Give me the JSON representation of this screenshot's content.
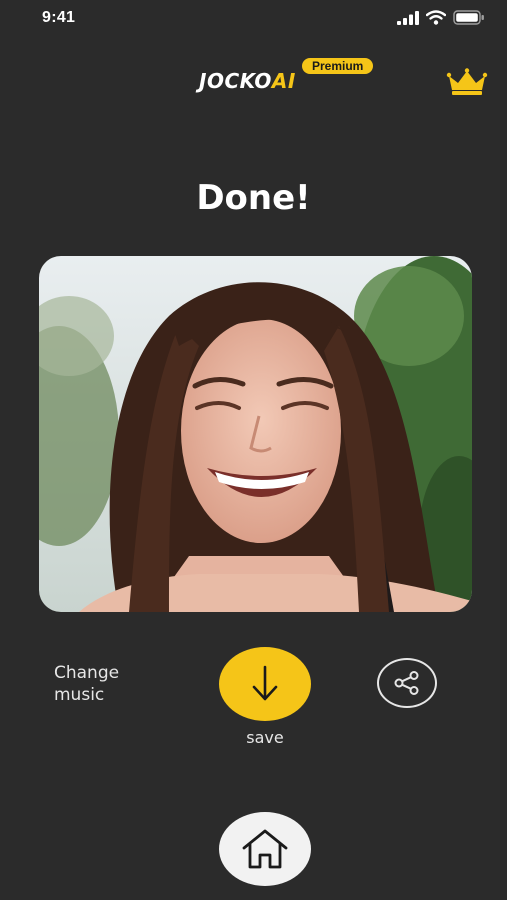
{
  "status_bar": {
    "time": "9:41",
    "icons": [
      "signal-icon",
      "wifi-icon",
      "battery-icon"
    ]
  },
  "header": {
    "logo_primary": "JOCKO",
    "logo_accent": "AI",
    "badge": "Premium",
    "crown_icon": "crown-icon"
  },
  "main": {
    "title": "Done!",
    "photo": "smiling-woman-photo"
  },
  "actions": {
    "change_music_label": "Change\nmusic",
    "save_label": "save",
    "save_icon": "download-arrow-icon",
    "share_icon": "share-icon"
  },
  "nav": {
    "home_icon": "home-icon"
  },
  "colors": {
    "background": "#2b2b2b",
    "accent": "#f5c518",
    "home_button": "#f2f2f2"
  }
}
